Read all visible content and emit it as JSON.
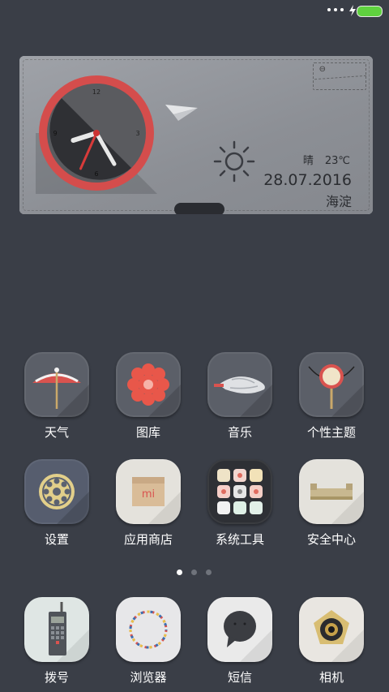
{
  "status_bar": {
    "battery_color": "#5fd13f"
  },
  "widget": {
    "clock": {
      "hour": 8,
      "minute": 25,
      "second": 34,
      "ring_color": "#d44d4c"
    },
    "weather": {
      "condition": "晴",
      "temperature": "23℃"
    },
    "date": "28.07.2016",
    "city": "海淀"
  },
  "apps_row1": [
    {
      "label": "天气",
      "icon": "umbrella-icon"
    },
    {
      "label": "图库",
      "icon": "flower-icon"
    },
    {
      "label": "音乐",
      "icon": "seashell-icon"
    },
    {
      "label": "个性主题",
      "icon": "fan-icon"
    }
  ],
  "apps_row2": [
    {
      "label": "设置",
      "icon": "gear-dial-icon"
    },
    {
      "label": "应用商店",
      "icon": "shopping-bag-icon"
    },
    {
      "label": "系统工具",
      "icon": "folder-grid-icon"
    },
    {
      "label": "安全中心",
      "icon": "shield-box-icon"
    }
  ],
  "dock": [
    {
      "label": "拨号",
      "icon": "retro-phone-icon"
    },
    {
      "label": "浏览器",
      "icon": "beaded-ring-icon"
    },
    {
      "label": "短信",
      "icon": "speech-bubble-icon"
    },
    {
      "label": "相机",
      "icon": "camera-lens-icon"
    }
  ],
  "pager": {
    "page_count": 3,
    "current_page": 1
  }
}
